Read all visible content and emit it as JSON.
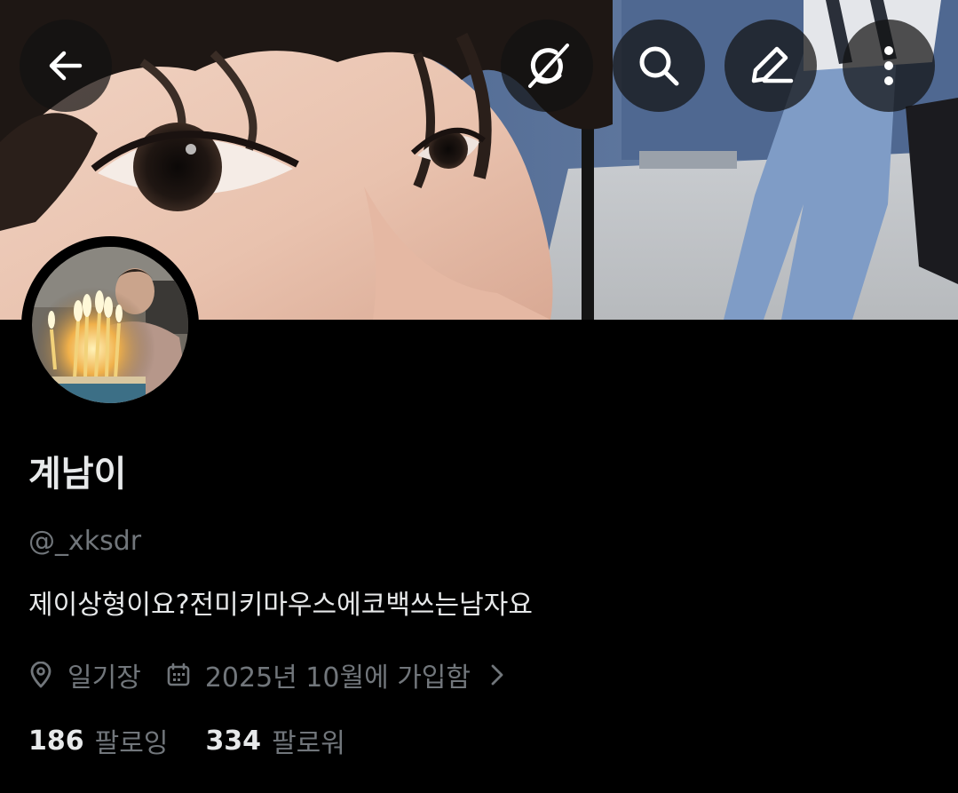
{
  "profile": {
    "display_name": "계남이",
    "handle": "@_xksdr",
    "bio": "제이상형이요?전미키마우스에코백쓰는남자요",
    "location": "일기장",
    "joined": "2025년 10월에 가입함",
    "following_count": "186",
    "following_label": "팔로잉",
    "followers_count": "334",
    "followers_label": "팔로워"
  },
  "icons": {
    "back": "arrow-left-icon",
    "grok": "grok-icon",
    "search": "search-icon",
    "edit": "edit-pencil-icon",
    "more": "more-vertical-icon",
    "location": "location-pin-icon",
    "calendar": "calendar-icon",
    "chevron": "chevron-right-icon"
  },
  "colors": {
    "background": "#000000",
    "primary_text": "#e7e9ea",
    "secondary_text": "#71767b"
  }
}
